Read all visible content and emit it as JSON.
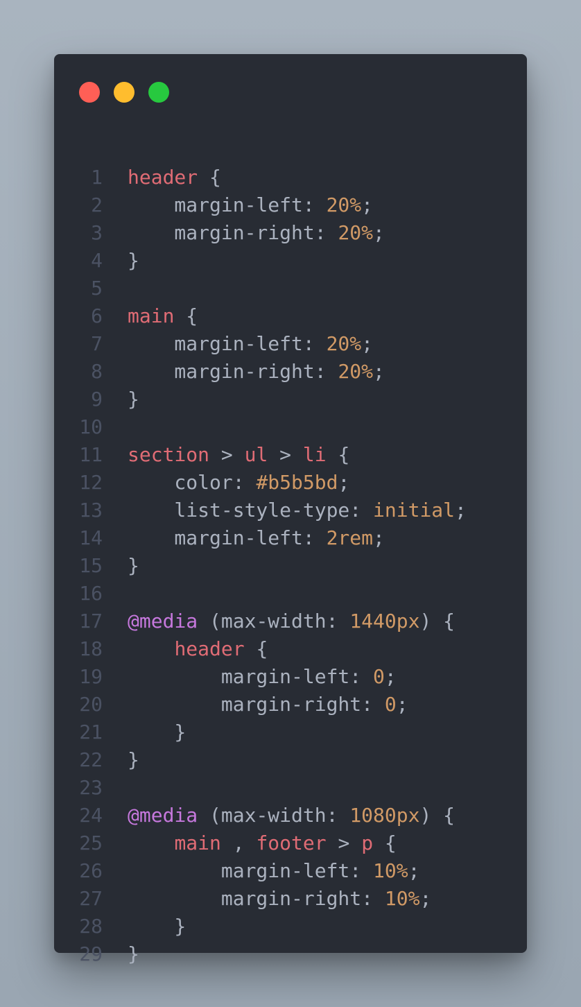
{
  "window": {
    "controls": [
      {
        "name": "close",
        "color": "#ff5f56"
      },
      {
        "name": "minimize",
        "color": "#ffbd2e"
      },
      {
        "name": "maximize",
        "color": "#27c93f"
      }
    ]
  },
  "theme": {
    "background": "#282c34",
    "text": "#abb2bf",
    "line_number": "#4b5263",
    "selector": "#e06c75",
    "number": "#d19a66",
    "at_rule": "#c678dd"
  },
  "code": {
    "lines": [
      [
        {
          "t": "header",
          "k": "sel"
        },
        {
          "t": " {",
          "k": "pun"
        }
      ],
      [
        {
          "t": "    margin-left: ",
          "k": "pun"
        },
        {
          "t": "20%",
          "k": "num"
        },
        {
          "t": ";",
          "k": "pun"
        }
      ],
      [
        {
          "t": "    margin-right: ",
          "k": "pun"
        },
        {
          "t": "20%",
          "k": "num"
        },
        {
          "t": ";",
          "k": "pun"
        }
      ],
      [
        {
          "t": "}",
          "k": "pun"
        }
      ],
      [],
      [
        {
          "t": "main",
          "k": "sel"
        },
        {
          "t": " {",
          "k": "pun"
        }
      ],
      [
        {
          "t": "    margin-left: ",
          "k": "pun"
        },
        {
          "t": "20%",
          "k": "num"
        },
        {
          "t": ";",
          "k": "pun"
        }
      ],
      [
        {
          "t": "    margin-right: ",
          "k": "pun"
        },
        {
          "t": "20%",
          "k": "num"
        },
        {
          "t": ";",
          "k": "pun"
        }
      ],
      [
        {
          "t": "}",
          "k": "pun"
        }
      ],
      [],
      [
        {
          "t": "section",
          "k": "sel"
        },
        {
          "t": " > ",
          "k": "pun"
        },
        {
          "t": "ul",
          "k": "sel"
        },
        {
          "t": " > ",
          "k": "pun"
        },
        {
          "t": "li",
          "k": "sel"
        },
        {
          "t": " {",
          "k": "pun"
        }
      ],
      [
        {
          "t": "    color: ",
          "k": "pun"
        },
        {
          "t": "#b5b5bd",
          "k": "num"
        },
        {
          "t": ";",
          "k": "pun"
        }
      ],
      [
        {
          "t": "    list-style-type: ",
          "k": "pun"
        },
        {
          "t": "initial",
          "k": "num"
        },
        {
          "t": ";",
          "k": "pun"
        }
      ],
      [
        {
          "t": "    margin-left: ",
          "k": "pun"
        },
        {
          "t": "2rem",
          "k": "num"
        },
        {
          "t": ";",
          "k": "pun"
        }
      ],
      [
        {
          "t": "}",
          "k": "pun"
        }
      ],
      [],
      [
        {
          "t": "@media",
          "k": "at"
        },
        {
          "t": " (max-width: ",
          "k": "pun"
        },
        {
          "t": "1440px",
          "k": "num"
        },
        {
          "t": ") {",
          "k": "pun"
        }
      ],
      [
        {
          "t": "    ",
          "k": "pun"
        },
        {
          "t": "header",
          "k": "sel"
        },
        {
          "t": " {",
          "k": "pun"
        }
      ],
      [
        {
          "t": "        margin-left: ",
          "k": "pun"
        },
        {
          "t": "0",
          "k": "num"
        },
        {
          "t": ";",
          "k": "pun"
        }
      ],
      [
        {
          "t": "        margin-right: ",
          "k": "pun"
        },
        {
          "t": "0",
          "k": "num"
        },
        {
          "t": ";",
          "k": "pun"
        }
      ],
      [
        {
          "t": "    }",
          "k": "pun"
        }
      ],
      [
        {
          "t": "}",
          "k": "pun"
        }
      ],
      [],
      [
        {
          "t": "@media",
          "k": "at"
        },
        {
          "t": " (max-width: ",
          "k": "pun"
        },
        {
          "t": "1080px",
          "k": "num"
        },
        {
          "t": ") {",
          "k": "pun"
        }
      ],
      [
        {
          "t": "    ",
          "k": "pun"
        },
        {
          "t": "main",
          "k": "sel"
        },
        {
          "t": " , ",
          "k": "pun"
        },
        {
          "t": "footer",
          "k": "sel"
        },
        {
          "t": " > ",
          "k": "pun"
        },
        {
          "t": "p",
          "k": "sel"
        },
        {
          "t": " {",
          "k": "pun"
        }
      ],
      [
        {
          "t": "        margin-left: ",
          "k": "pun"
        },
        {
          "t": "10%",
          "k": "num"
        },
        {
          "t": ";",
          "k": "pun"
        }
      ],
      [
        {
          "t": "        margin-right: ",
          "k": "pun"
        },
        {
          "t": "10%",
          "k": "num"
        },
        {
          "t": ";",
          "k": "pun"
        }
      ],
      [
        {
          "t": "    }",
          "k": "pun"
        }
      ],
      [
        {
          "t": "}",
          "k": "pun"
        }
      ]
    ]
  }
}
